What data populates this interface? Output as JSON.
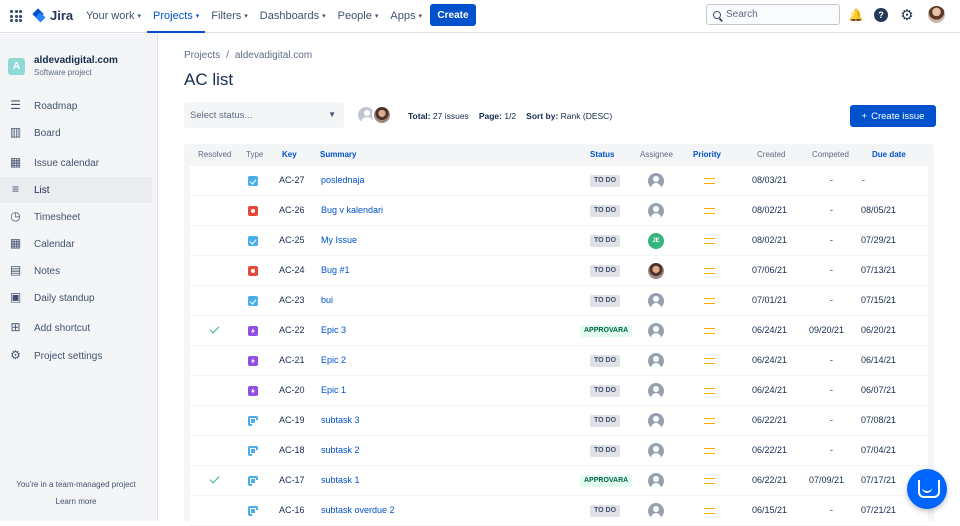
{
  "topbar": {
    "app_name": "Jira",
    "nav": [
      {
        "label": "Your work",
        "active": false
      },
      {
        "label": "Projects",
        "active": true
      },
      {
        "label": "Filters",
        "active": false
      },
      {
        "label": "Dashboards",
        "active": false
      },
      {
        "label": "People",
        "active": false
      },
      {
        "label": "Apps",
        "active": false
      }
    ],
    "create_label": "Create",
    "search_placeholder": "Search",
    "help_glyph": "?"
  },
  "sidebar": {
    "project_initial": "A",
    "project_name": "aldevadigital.com",
    "project_type": "Software project",
    "items": [
      {
        "label": "Roadmap",
        "icon": "roadmap-icon"
      },
      {
        "label": "Board",
        "icon": "board-icon"
      },
      {
        "label": "Issue calendar",
        "icon": "calendar-icon"
      },
      {
        "label": "List",
        "icon": "list-icon",
        "active": true
      },
      {
        "label": "Timesheet",
        "icon": "timesheet-icon"
      },
      {
        "label": "Calendar",
        "icon": "calendar-icon"
      },
      {
        "label": "Notes",
        "icon": "notes-icon"
      },
      {
        "label": "Daily standup",
        "icon": "standup-icon"
      },
      {
        "label": "Add shortcut",
        "icon": "add-shortcut-icon"
      },
      {
        "label": "Project settings",
        "icon": "gear-icon"
      }
    ],
    "footer_text": "You're in a team-managed project",
    "footer_link": "Learn more"
  },
  "main": {
    "breadcrumb": [
      "Projects",
      "/",
      "aldevadigital.com"
    ],
    "title": "AC list",
    "status_placeholder": "Select status...",
    "total_label": "Total:",
    "total_value": "27 issues",
    "page_label": "Page:",
    "page_value": "1/2",
    "sort_label": "Sort by:",
    "sort_value": "Rank (DESC)",
    "create_issue_label": "Create issue"
  },
  "table": {
    "headers": {
      "resolved": "Resolved",
      "type": "Type",
      "key": "Key",
      "summary": "Summary",
      "status": "Status",
      "assignee": "Assignee",
      "priority": "Priority",
      "created": "Created",
      "competed": "Competed",
      "due": "Due date"
    },
    "rows": [
      {
        "resolved": false,
        "type": "task",
        "key": "AC-27",
        "summary": "poslednaja",
        "status": "TO DO",
        "assignee": "generic",
        "created": "08/03/21",
        "competed": "-",
        "due": "-"
      },
      {
        "resolved": false,
        "type": "bug",
        "key": "AC-26",
        "summary": "Bug v kalendari",
        "status": "TO DO",
        "assignee": "generic",
        "created": "08/02/21",
        "competed": "-",
        "due": "08/05/21"
      },
      {
        "resolved": false,
        "type": "task",
        "key": "AC-25",
        "summary": "My Issue",
        "status": "TO DO",
        "assignee": "initials",
        "initials": "JE",
        "created": "08/02/21",
        "competed": "-",
        "due": "07/29/21"
      },
      {
        "resolved": false,
        "type": "bug",
        "key": "AC-24",
        "summary": "Bug #1",
        "status": "TO DO",
        "assignee": "photo",
        "created": "07/06/21",
        "competed": "-",
        "due": "07/13/21"
      },
      {
        "resolved": false,
        "type": "task",
        "key": "AC-23",
        "summary": "bui",
        "status": "TO DO",
        "assignee": "generic",
        "created": "07/01/21",
        "competed": "-",
        "due": "07/15/21"
      },
      {
        "resolved": true,
        "type": "epic",
        "key": "AC-22",
        "summary": "Epic 3",
        "status": "APPROVARA",
        "assignee": "generic",
        "created": "06/24/21",
        "competed": "09/20/21",
        "due": "06/20/21"
      },
      {
        "resolved": false,
        "type": "epic",
        "key": "AC-21",
        "summary": "Epic 2",
        "status": "TO DO",
        "assignee": "generic",
        "created": "06/24/21",
        "competed": "-",
        "due": "06/14/21"
      },
      {
        "resolved": false,
        "type": "epic",
        "key": "AC-20",
        "summary": "Epic 1",
        "status": "TO DO",
        "assignee": "generic",
        "created": "06/24/21",
        "competed": "-",
        "due": "06/07/21"
      },
      {
        "resolved": false,
        "type": "subtask",
        "key": "AC-19",
        "summary": "subtask 3",
        "status": "TO DO",
        "assignee": "generic",
        "created": "06/22/21",
        "competed": "-",
        "due": "07/08/21"
      },
      {
        "resolved": false,
        "type": "subtask",
        "key": "AC-18",
        "summary": "subtask 2",
        "status": "TO DO",
        "assignee": "generic",
        "created": "06/22/21",
        "competed": "-",
        "due": "07/04/21"
      },
      {
        "resolved": true,
        "type": "subtask",
        "key": "AC-17",
        "summary": "subtask 1",
        "status": "APPROVARA",
        "assignee": "generic",
        "created": "06/22/21",
        "competed": "07/09/21",
        "due": "07/17/21"
      },
      {
        "resolved": false,
        "type": "subtask",
        "key": "AC-16",
        "summary": "subtask overdue 2",
        "status": "TO DO",
        "assignee": "generic",
        "created": "06/15/21",
        "competed": "-",
        "due": "07/21/21"
      }
    ]
  },
  "colors": {
    "brand": "#0052cc",
    "todo_bg": "#dfe1e6",
    "done_bg": "#e3fcef",
    "done_text": "#006644",
    "priority_medium": "#ffab00"
  }
}
